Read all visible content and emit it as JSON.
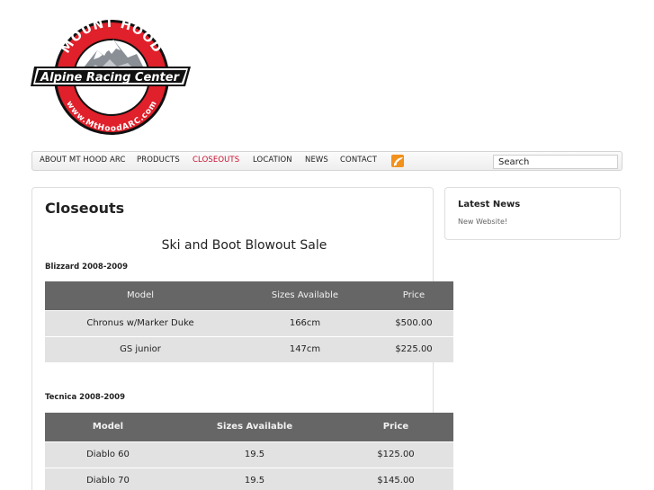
{
  "logo": {
    "top_text": "MOUNT HOOD",
    "banner_text": "Alpine Racing Center",
    "bottom_text": "www.MtHoodARC.com",
    "colors": {
      "red": "#e0202a",
      "black": "#111111",
      "white": "#ffffff"
    }
  },
  "nav": {
    "items": [
      {
        "label": "ABOUT MT HOOD ARC"
      },
      {
        "label": "PRODUCTS"
      },
      {
        "label": "CLOSEOUTS"
      },
      {
        "label": "LOCATION"
      },
      {
        "label": "NEWS"
      },
      {
        "label": "CONTACT"
      }
    ],
    "active_index": 2,
    "active_color": "#c8102e",
    "rss_icon": "rss-icon",
    "search": {
      "value": "Search"
    }
  },
  "main": {
    "title": "Closeouts",
    "sale_title": "Ski and Boot Blowout Sale",
    "sections": [
      {
        "label": "Blizzard 2008-2009",
        "headers": [
          "Model",
          "Sizes Available",
          "Price"
        ],
        "rows": [
          [
            "Chronus w/Marker Duke",
            "166cm",
            "$500.00"
          ],
          [
            "GS junior",
            "147cm",
            "$225.00"
          ]
        ]
      },
      {
        "label": "Tecnica 2008-2009",
        "headers": [
          "Model",
          "Sizes Available",
          "Price"
        ],
        "rows": [
          [
            "Diablo 60",
            "19.5",
            "$125.00"
          ],
          [
            "Diablo 70",
            "19.5",
            "$145.00"
          ]
        ]
      }
    ]
  },
  "sidebar": {
    "title": "Latest News",
    "link": "New Website!"
  }
}
